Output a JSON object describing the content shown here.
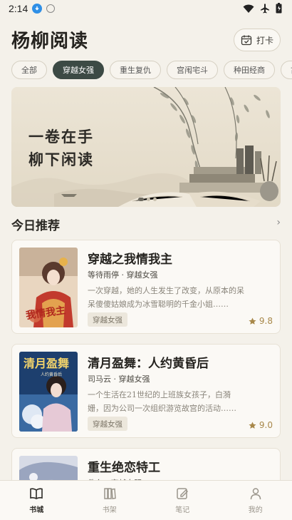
{
  "status_bar": {
    "time": "2:14"
  },
  "header": {
    "title": "杨柳阅读",
    "checkin_label": "打卡"
  },
  "categories": [
    {
      "label": "全部",
      "active": false
    },
    {
      "label": "穿越女强",
      "active": true
    },
    {
      "label": "重生复仇",
      "active": false
    },
    {
      "label": "宫闱宅斗",
      "active": false
    },
    {
      "label": "种田经商",
      "active": false
    },
    {
      "label": "古代",
      "active": false
    }
  ],
  "banner": {
    "line1": "一卷在手",
    "line2": "柳下闲读"
  },
  "section": {
    "title": "今日推荐",
    "more": "›"
  },
  "books": [
    {
      "title": "穿越之我情我主",
      "meta": "等待雨停 · 穿越女强",
      "desc": "一次穿越，她的人生发生了改变，从原本的呆呆傻傻姑娘成为冰雪聪明的千金小姐……",
      "tag": "穿越女强",
      "rating": "9.8",
      "cover_text": "穿越之我情我主"
    },
    {
      "title": "清月盈舞：人约黄昏后",
      "meta": "司马云 · 穿越女强",
      "desc": "一个生活在21世纪的上班族女孩子，白漪姗，因为公司一次组织游览故宫的活动……",
      "tag": "穿越女强",
      "rating": "9.0",
      "cover_text": "清月盈舞"
    },
    {
      "title": "重生绝恋特工",
      "meta": "佚名 · 穿越女强",
      "desc": "",
      "tag": "",
      "rating": "",
      "cover_text": ""
    }
  ],
  "bottom_nav": [
    {
      "label": "书城",
      "icon": "book-open-icon",
      "active": true
    },
    {
      "label": "书架",
      "icon": "bookshelf-icon",
      "active": false
    },
    {
      "label": "笔记",
      "icon": "note-edit-icon",
      "active": false
    },
    {
      "label": "我的",
      "icon": "user-icon",
      "active": false
    }
  ],
  "colors": {
    "accent": "#3c4a45",
    "background": "#f4f1ea",
    "rating": "#a8884a"
  }
}
